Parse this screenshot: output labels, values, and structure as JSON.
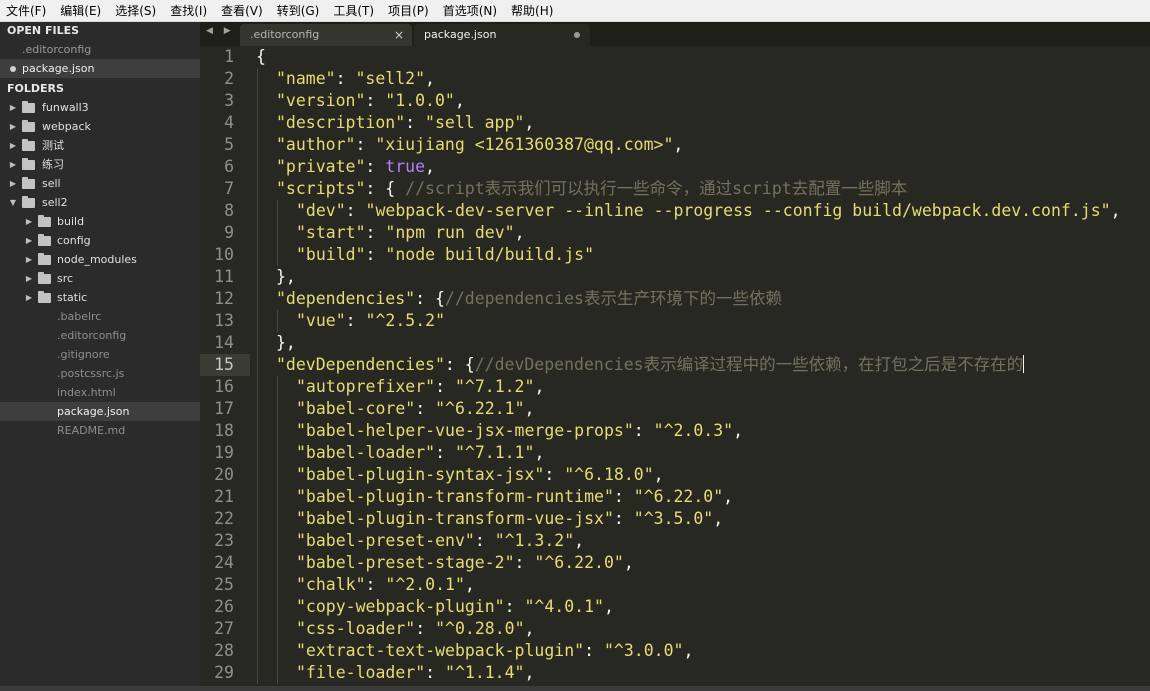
{
  "menu": [
    "文件(F)",
    "编辑(E)",
    "选择(S)",
    "查找(I)",
    "查看(V)",
    "转到(G)",
    "工具(T)",
    "项目(P)",
    "首选项(N)",
    "帮助(H)"
  ],
  "sidebar": {
    "open_files_title": "OPEN FILES",
    "open_files": [
      ".editorconfig",
      "package.json"
    ],
    "folders_title": "FOLDERS",
    "tree": [
      "funwall3",
      "webpack",
      "测试",
      "练习",
      "sell",
      "sell2",
      "build",
      "config",
      "node_modules",
      "src",
      "static",
      ".babelrc",
      ".editorconfig",
      ".gitignore",
      ".postcssrc.js",
      "index.html",
      "package.json",
      "README.md"
    ]
  },
  "tabs": [
    {
      "label": ".editorconfig"
    },
    {
      "label": "package.json"
    }
  ],
  "tab_nav": "◀ ▶",
  "close_glyph": "×",
  "code": {
    "current_line": 15,
    "lines": [
      {
        "n": "1",
        "t": "{"
      },
      {
        "n": "2",
        "k": "\"name\"",
        "v": "\"sell2\"",
        "e": ","
      },
      {
        "n": "3",
        "k": "\"version\"",
        "v": "\"1.0.0\"",
        "e": ","
      },
      {
        "n": "4",
        "k": "\"description\"",
        "v": "\"sell app\"",
        "e": ","
      },
      {
        "n": "5",
        "k": "\"author\"",
        "v": "\"xiujiang <1261360387@qq.com>\"",
        "e": ","
      },
      {
        "n": "6",
        "k": "\"private\"",
        "b": "true",
        "e": ","
      },
      {
        "n": "7",
        "k": "\"scripts\"",
        "o": "{ ",
        "c": "//script表示我们可以执行一些命令，通过script去配置一些脚本"
      },
      {
        "n": "8",
        "k": "\"dev\"",
        "v": "\"webpack-dev-server --inline --progress --config build/webpack.dev.conf.js\"",
        "e": ","
      },
      {
        "n": "9",
        "k": "\"start\"",
        "v": "\"npm run dev\"",
        "e": ","
      },
      {
        "n": "10",
        "k": "\"build\"",
        "v": "\"node build/build.js\""
      },
      {
        "n": "11",
        "t": "},"
      },
      {
        "n": "12",
        "k": "\"dependencies\"",
        "o": "{",
        "c": "//dependencies表示生产环境下的一些依赖"
      },
      {
        "n": "13",
        "k": "\"vue\"",
        "v": "\"^2.5.2\""
      },
      {
        "n": "14",
        "t": "},"
      },
      {
        "n": "15",
        "k": "\"devDependencies\"",
        "o": "{",
        "c": "//devDependencies表示编译过程中的一些依赖，在打包之后是不存在的"
      },
      {
        "n": "16",
        "k": "\"autoprefixer\"",
        "v": "\"^7.1.2\"",
        "e": ","
      },
      {
        "n": "17",
        "k": "\"babel-core\"",
        "v": "\"^6.22.1\"",
        "e": ","
      },
      {
        "n": "18",
        "k": "\"babel-helper-vue-jsx-merge-props\"",
        "v": "\"^2.0.3\"",
        "e": ","
      },
      {
        "n": "19",
        "k": "\"babel-loader\"",
        "v": "\"^7.1.1\"",
        "e": ","
      },
      {
        "n": "20",
        "k": "\"babel-plugin-syntax-jsx\"",
        "v": "\"^6.18.0\"",
        "e": ","
      },
      {
        "n": "21",
        "k": "\"babel-plugin-transform-runtime\"",
        "v": "\"^6.22.0\"",
        "e": ","
      },
      {
        "n": "22",
        "k": "\"babel-plugin-transform-vue-jsx\"",
        "v": "\"^3.5.0\"",
        "e": ","
      },
      {
        "n": "23",
        "k": "\"babel-preset-env\"",
        "v": "\"^1.3.2\"",
        "e": ","
      },
      {
        "n": "24",
        "k": "\"babel-preset-stage-2\"",
        "v": "\"^6.22.0\"",
        "e": ","
      },
      {
        "n": "25",
        "k": "\"chalk\"",
        "v": "\"^2.0.1\"",
        "e": ","
      },
      {
        "n": "26",
        "k": "\"copy-webpack-plugin\"",
        "v": "\"^4.0.1\"",
        "e": ","
      },
      {
        "n": "27",
        "k": "\"css-loader\"",
        "v": "\"^0.28.0\"",
        "e": ","
      },
      {
        "n": "28",
        "k": "\"extract-text-webpack-plugin\"",
        "v": "\"^3.0.0\"",
        "e": ","
      },
      {
        "n": "29",
        "k": "\"file-loader\"",
        "v": "\"^1.1.4\"",
        "e": ","
      }
    ]
  }
}
